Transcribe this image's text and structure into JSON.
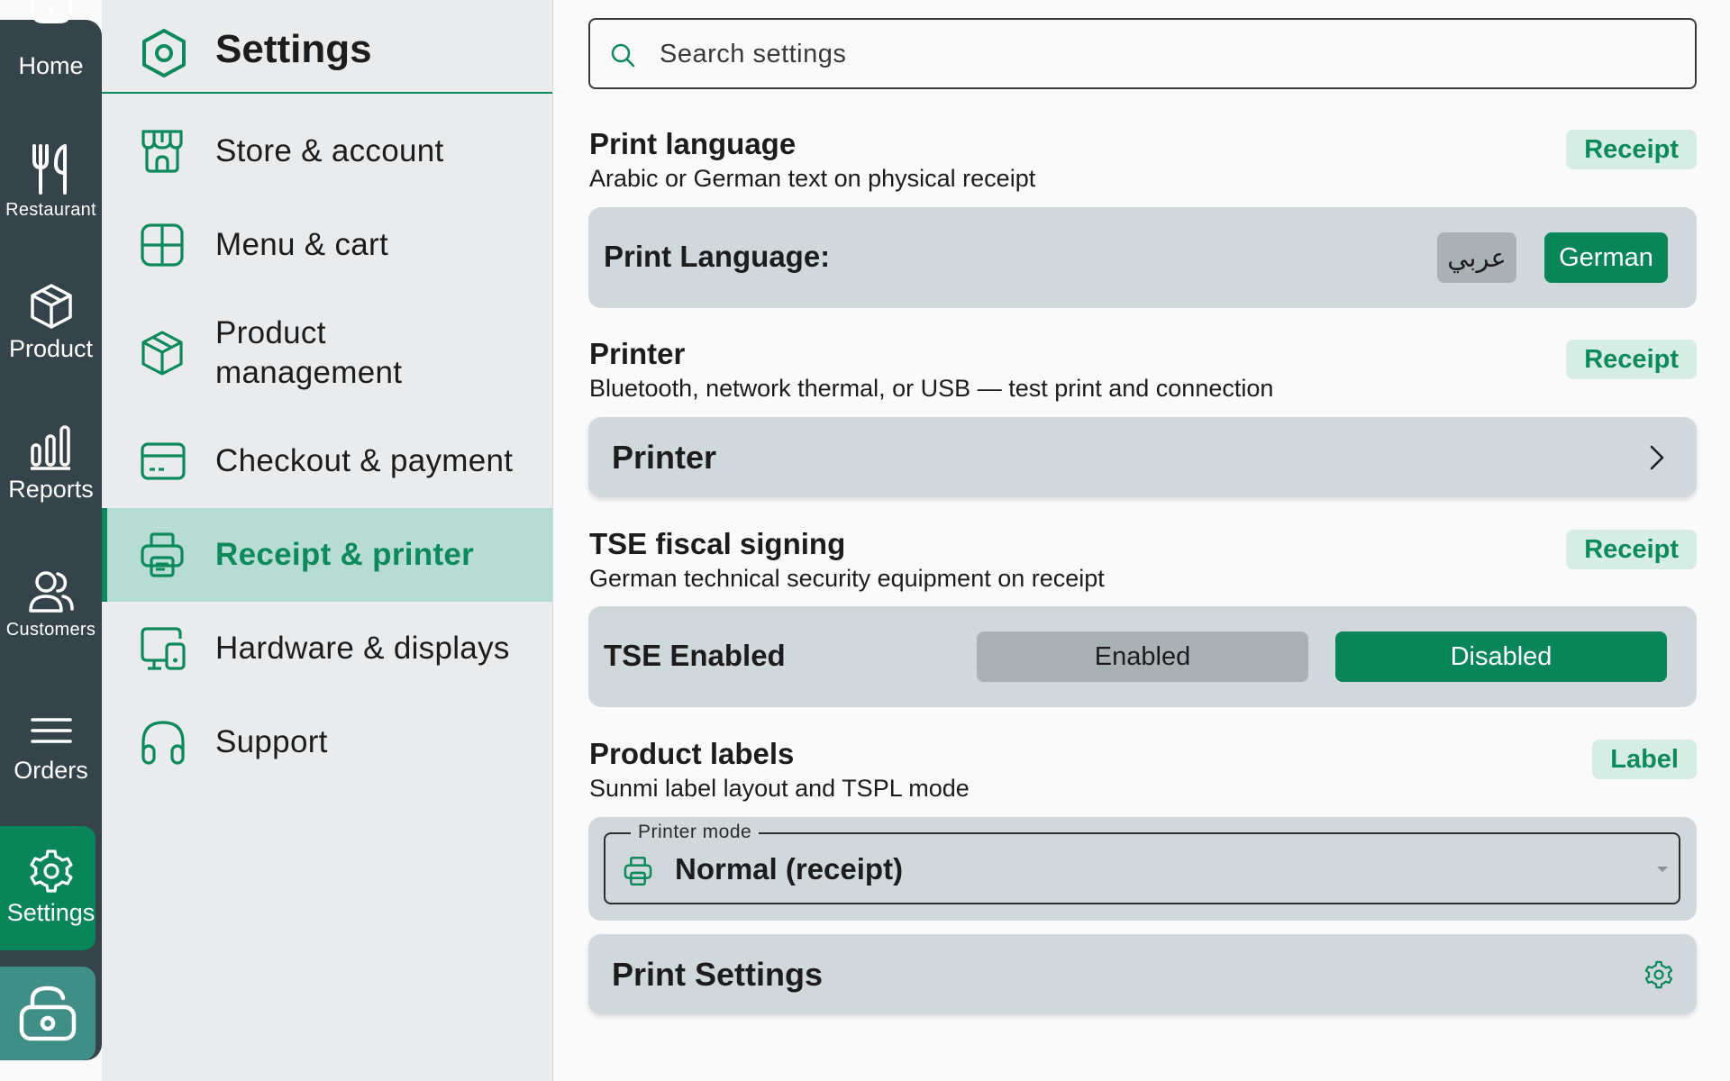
{
  "rail": {
    "items": [
      {
        "label": "Home",
        "icon": "home-icon"
      },
      {
        "label": "Restaurant",
        "icon": "fork-knife-icon"
      },
      {
        "label": "Product",
        "icon": "box-icon"
      },
      {
        "label": "Reports",
        "icon": "bar-chart-icon"
      },
      {
        "label": "Customers",
        "icon": "users-icon"
      },
      {
        "label": "Orders",
        "icon": "menu-lines-icon"
      },
      {
        "label": "Settings",
        "icon": "gear-icon"
      }
    ],
    "active": "Settings",
    "lock_icon": "lock-icon"
  },
  "settings_nav": {
    "title": "Settings",
    "items": [
      {
        "label": "Store & account",
        "icon": "storefront-icon"
      },
      {
        "label": "Menu & cart",
        "icon": "grid-icon"
      },
      {
        "label": "Product management",
        "icon": "package-icon"
      },
      {
        "label": "Checkout & payment",
        "icon": "card-icon"
      },
      {
        "label": "Receipt & printer",
        "icon": "printer-icon"
      },
      {
        "label": "Hardware & displays",
        "icon": "devices-icon"
      },
      {
        "label": "Support",
        "icon": "headphones-icon"
      }
    ],
    "active": "Receipt & printer"
  },
  "search": {
    "placeholder": "Search settings"
  },
  "sections": {
    "print_language": {
      "title": "Print language",
      "desc": "Arabic or German text on physical receipt",
      "badge": "Receipt",
      "row_label": "Print Language:",
      "option_arabic": "عربي",
      "option_german": "German",
      "selected": "German"
    },
    "printer": {
      "title": "Printer",
      "desc": "Bluetooth, network thermal, or USB — test print and connection",
      "badge": "Receipt",
      "link_label": "Printer"
    },
    "tse": {
      "title": "TSE fiscal signing",
      "desc": "German technical security equipment on receipt",
      "badge": "Receipt",
      "row_label": "TSE Enabled",
      "option_enabled": "Enabled",
      "option_disabled": "Disabled",
      "selected": "Disabled"
    },
    "product_labels": {
      "title": "Product labels",
      "desc": "Sunmi label layout and TSPL mode",
      "badge": "Label",
      "select_legend": "Printer mode",
      "select_value": "Normal (receipt)"
    },
    "print_settings": {
      "link_label": "Print Settings"
    }
  },
  "colors": {
    "accent": "#08865a",
    "rail": "#35434a",
    "card": "#d0d8db",
    "badge_bg": "#d6ede5",
    "nav_active_bg": "#b7dcd4"
  }
}
